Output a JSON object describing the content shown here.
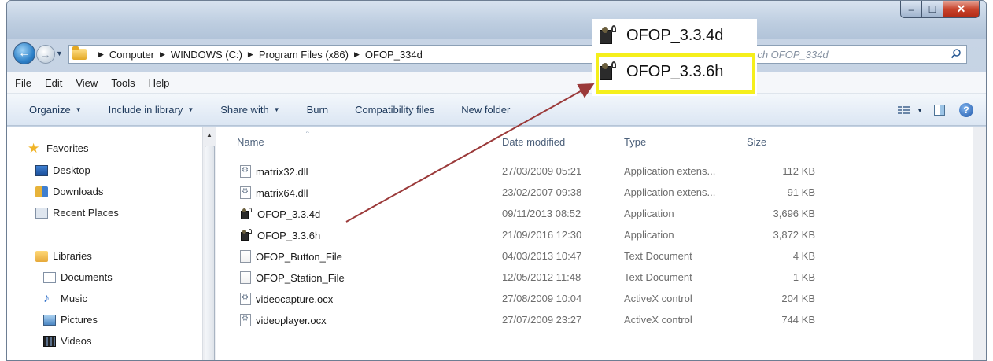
{
  "window": {
    "caption_min": "–",
    "caption_max": "☐",
    "caption_close": "✕"
  },
  "address_bar": {
    "crumbs": [
      "Computer",
      "WINDOWS (C:)",
      "Program Files (x86)",
      "OFOP_334d"
    ],
    "separator": "▶",
    "search_placeholder": "Search OFOP_334d",
    "search_visible_text": "rch OFOP_334d"
  },
  "menu": [
    "File",
    "Edit",
    "View",
    "Tools",
    "Help"
  ],
  "toolbar": {
    "organize": "Organize",
    "include_in_library": "Include in library",
    "share_with": "Share with",
    "burn": "Burn",
    "compatibility_files": "Compatibility files",
    "new_folder": "New folder",
    "dropdown_glyph": "▼"
  },
  "nav": {
    "favorites": "Favorites",
    "desktop": "Desktop",
    "downloads": "Downloads",
    "recent_places": "Recent Places",
    "libraries": "Libraries",
    "documents": "Documents",
    "music": "Music",
    "pictures": "Pictures",
    "videos": "Videos"
  },
  "columns": {
    "name": "Name",
    "date": "Date modified",
    "type": "Type",
    "size": "Size"
  },
  "files": [
    {
      "name": "matrix32.dll",
      "date": "27/03/2009 05:21",
      "type": "Application extens...",
      "size": "112 KB",
      "icon": "dll-file-icon"
    },
    {
      "name": "matrix64.dll",
      "date": "23/02/2007 09:38",
      "type": "Application extens...",
      "size": "91 KB",
      "icon": "dll-file-icon"
    },
    {
      "name": "OFOP_3.3.4d",
      "date": "09/11/2013 08:52",
      "type": "Application",
      "size": "3,696 KB",
      "icon": "application-icon"
    },
    {
      "name": "OFOP_3.3.6h",
      "date": "21/09/2016 12:30",
      "type": "Application",
      "size": "3,872 KB",
      "icon": "application-icon"
    },
    {
      "name": "OFOP_Button_File",
      "date": "04/03/2013 10:47",
      "type": "Text Document",
      "size": "4 KB",
      "icon": "text-file-icon"
    },
    {
      "name": "OFOP_Station_File",
      "date": "12/05/2012 11:48",
      "type": "Text Document",
      "size": "1 KB",
      "icon": "text-file-icon"
    },
    {
      "name": "videocapture.ocx",
      "date": "27/08/2009 10:04",
      "type": "ActiveX control",
      "size": "204 KB",
      "icon": "ocx-file-icon"
    },
    {
      "name": "videoplayer.ocx",
      "date": "27/07/2009 23:27",
      "type": "ActiveX control",
      "size": "744 KB",
      "icon": "ocx-file-icon"
    }
  ],
  "callout": {
    "item1": "OFOP_3.3.4d",
    "item2": "OFOP_3.3.6h",
    "highlight_color": "#f5ef1c",
    "arrow_color": "#9b3a3a"
  }
}
